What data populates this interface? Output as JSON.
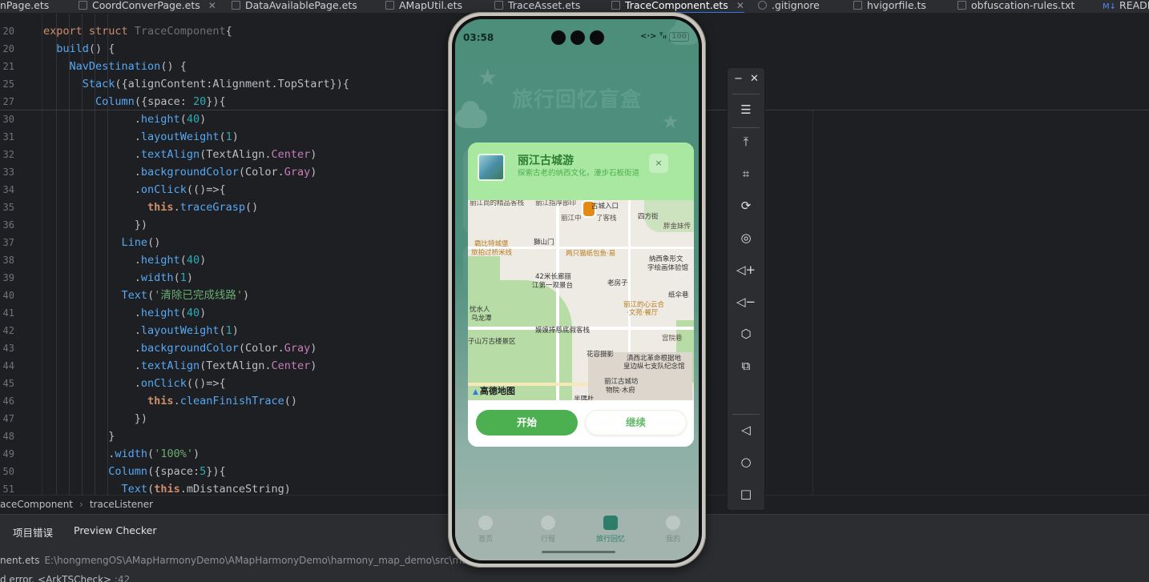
{
  "tabs": [
    {
      "label": "nPage.ets",
      "active": false
    },
    {
      "label": "CoordConverPage.ets",
      "active": false,
      "closable": true
    },
    {
      "label": "DataAvailablePage.ets",
      "active": false
    },
    {
      "label": "AMapUtil.ets",
      "active": false
    },
    {
      "label": "TraceAsset.ets",
      "active": false
    },
    {
      "label": "TraceComponent.ets",
      "active": true,
      "closable": true
    },
    {
      "label": ".gitignore",
      "active": false
    },
    {
      "label": "hvigorfile.ts",
      "active": false
    },
    {
      "label": "obfuscation-rules.txt",
      "active": false
    },
    {
      "label": "READM",
      "active": false
    }
  ],
  "editor": {
    "lines": [
      {
        "n": "20",
        "t": "export struct TraceComponent{"
      },
      {
        "n": "20",
        "t": "  build() {"
      },
      {
        "n": "21",
        "t": "    NavDestination() {"
      },
      {
        "n": "25",
        "t": "      Stack({alignContent:Alignment.TopStart}){"
      },
      {
        "n": "27",
        "t": "        Column({space: 20}){"
      },
      {
        "n": "30",
        "t": "              .height(40)"
      },
      {
        "n": "31",
        "t": "              .layoutWeight(1)"
      },
      {
        "n": "32",
        "t": "              .textAlign(TextAlign.Center)"
      },
      {
        "n": "33",
        "t": "              .backgroundColor(Color.Gray)"
      },
      {
        "n": "34",
        "t": "              .onClick(()=>{"
      },
      {
        "n": "35",
        "t": "                this.traceGrasp()"
      },
      {
        "n": "36",
        "t": "              })"
      },
      {
        "n": "37",
        "t": "            Line()"
      },
      {
        "n": "38",
        "t": "              .height(40)"
      },
      {
        "n": "39",
        "t": "              .width(1)"
      },
      {
        "n": "40",
        "t": "            Text('清除已完成线路')"
      },
      {
        "n": "41",
        "t": "              .height(40)"
      },
      {
        "n": "42",
        "t": "              .layoutWeight(1)"
      },
      {
        "n": "43",
        "t": "              .backgroundColor(Color.Gray)"
      },
      {
        "n": "44",
        "t": "              .textAlign(TextAlign.Center)"
      },
      {
        "n": "45",
        "t": "              .onClick(()=>{"
      },
      {
        "n": "46",
        "t": "                this.cleanFinishTrace()"
      },
      {
        "n": "47",
        "t": "              })"
      },
      {
        "n": "48",
        "t": "          }"
      },
      {
        "n": "49",
        "t": "          .width('100%')"
      },
      {
        "n": "50",
        "t": "          Column({space:5}){"
      },
      {
        "n": "51",
        "t": "            Text(this.mDistanceString)"
      }
    ]
  },
  "breadcrumb": {
    "item1": "aceComponent",
    "sep": "›",
    "item2": "traceListener"
  },
  "panel": {
    "tab1": "项目错误",
    "tab2": "Preview Checker",
    "file_name": "nent.ets",
    "file_path": "E:\\hongmengOS\\AMapHarmonyDemo\\AMapHarmonyDemo\\harmony_map_demo\\src\\ma",
    "error_text": "d error. <ArkTSCheck>",
    "error_loc": ":42"
  },
  "phone": {
    "status_time": "03:58",
    "status_icons": "<·> ᵀᵢₗ",
    "battery": "100",
    "app_title": "旅行回忆盲盒",
    "dialog": {
      "title": "丽江古城游",
      "subtitle": "探索古老的纳西文化，漫步石板街道",
      "close": "×",
      "start_button": "开始",
      "continue_button": "继续"
    },
    "map": {
      "logo": "高德地图",
      "labels": [
        "丽江尚的精品客栈",
        "丽江指厚部印",
        "古城入口",
        "四方街",
        "胖金妹传",
        "丽江中",
        "了客栈",
        "獅山门",
        "霸比特城堡",
        "旅拍过桥米线",
        "两只猫纸包鱼·易",
        "纳西象形文",
        "字绘画体验馆",
        "42米长廊丽",
        "江第一观景台",
        "老房子",
        "纸伞巷",
        "丽江的心云合",
        "·文苑·餐厅",
        "忧水人",
        "乌龙潭",
        "嫫嫫捧慈底假客栈",
        "宫院巷",
        "子山万古楼景区",
        "花容摄影",
        "滇西北革命根据地",
        "皇边纵七支队纪念馆",
        "丽江古城坊",
        "物院·木府",
        "半隅杜"
      ]
    },
    "nav": [
      {
        "label": "首页"
      },
      {
        "label": "行程"
      },
      {
        "label": "旅行回忆"
      },
      {
        "label": "我的"
      }
    ]
  },
  "emulator": {
    "minimize": "−",
    "close": "✕"
  },
  "colors": {
    "accent_green": "#4caf50",
    "dialog_header": "#a9e8a0",
    "ide_bg": "#1e1f22",
    "keyword": "#cf8e6d",
    "string": "#6aab73",
    "number": "#2aacb8"
  }
}
